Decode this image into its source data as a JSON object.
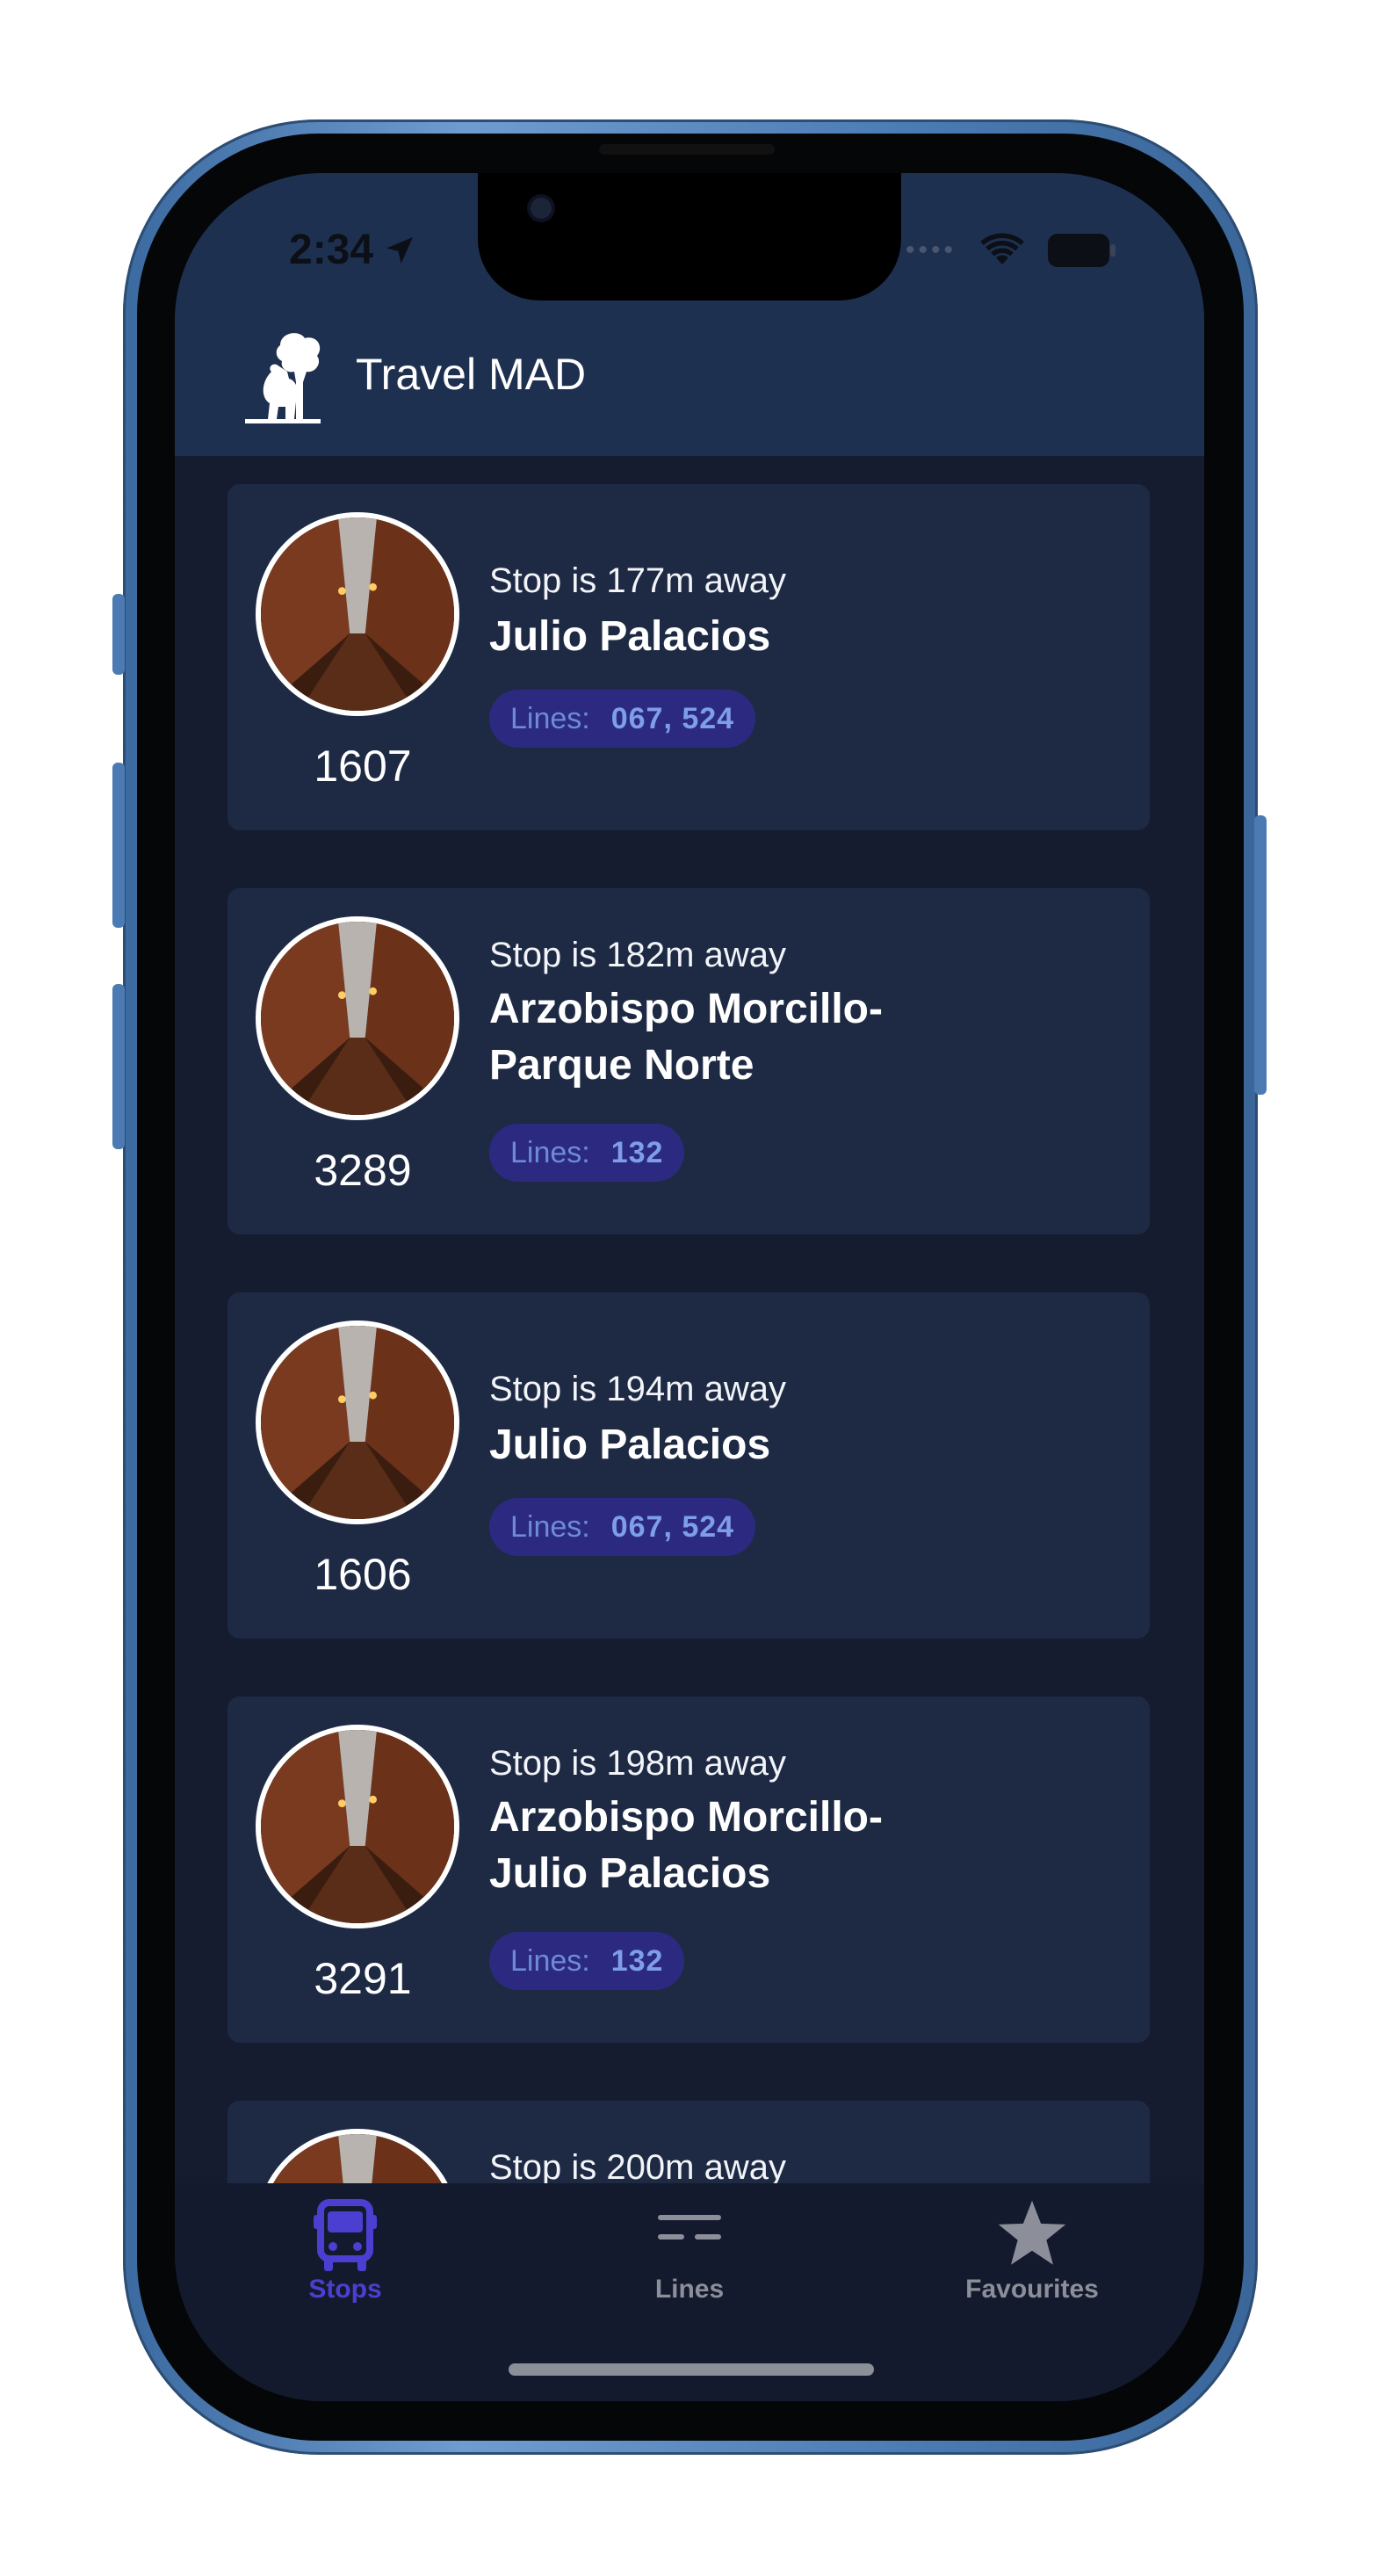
{
  "status_bar": {
    "time": "2:34"
  },
  "app": {
    "title": "Travel MAD"
  },
  "stops": [
    {
      "code": "1607",
      "distance": "Stop is 177m away",
      "name": "Julio Palacios",
      "lines_label": "Lines:",
      "lines": "067, 524"
    },
    {
      "code": "3289",
      "distance": "Stop is 182m away",
      "name": "Arzobispo Morcillo-\nParque Norte",
      "lines_label": "Lines:",
      "lines": "132"
    },
    {
      "code": "1606",
      "distance": "Stop is 194m away",
      "name": "Julio Palacios",
      "lines_label": "Lines:",
      "lines": "067, 524"
    },
    {
      "code": "3291",
      "distance": "Stop is 198m away",
      "name": "Arzobispo Morcillo-\nJulio Palacios",
      "lines_label": "Lines:",
      "lines": "132"
    },
    {
      "distance": "Stop is 200m away"
    }
  ],
  "tabbar": {
    "stops": "Stops",
    "lines": "Lines",
    "favourites": "Favourites"
  },
  "colors": {
    "header_bg": "#1e3050",
    "card_bg": "#1e2a44",
    "list_bg": "#151c30",
    "badge_bg": "#2b2a80",
    "active_tab": "#4a3fd0",
    "inactive_tab": "#8c8f99"
  },
  "icons": {
    "tab_stops": "bus-icon",
    "tab_lines": "lines-icon",
    "tab_favourites": "star-icon",
    "logo": "bear-and-tree-logo"
  }
}
